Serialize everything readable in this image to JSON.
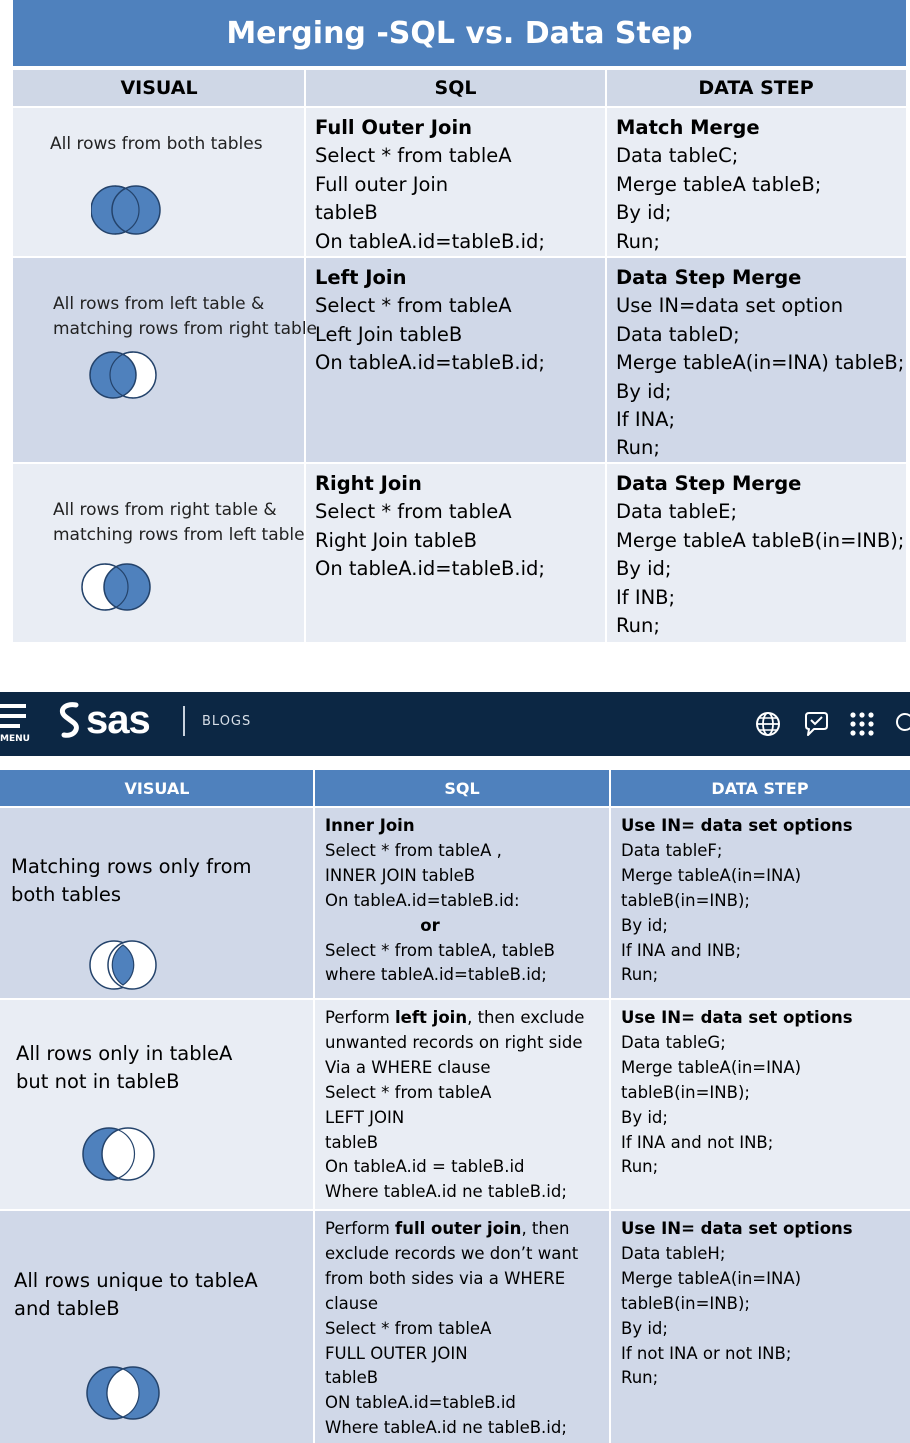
{
  "top_table": {
    "title": "Merging -SQL vs. Data Step",
    "headers": {
      "visual": "VISUAL",
      "sql": "SQL",
      "datastep": "DATA STEP"
    },
    "rows": [
      {
        "visual_lines": [
          "All rows from both tables"
        ],
        "sql_title": "Full Outer Join",
        "sql_lines": [
          "Select * from tableA",
          "Full outer Join",
          "tableB",
          "On tableA.id=tableB.id;"
        ],
        "ds_title": "Match Merge",
        "ds_lines": [
          "Data tableC;",
          "Merge tableA tableB;",
          "By id;",
          "Run;"
        ]
      },
      {
        "visual_lines": [
          "All rows from left table &",
          "matching rows from right table"
        ],
        "sql_title": "Left Join",
        "sql_lines": [
          "Select * from tableA",
          "Left Join tableB",
          "On tableA.id=tableB.id;"
        ],
        "ds_title": "Data Step Merge",
        "ds_lines": [
          "Use IN=data set option",
          "Data tableD;",
          "Merge tableA(in=INA) tableB;",
          "By id;",
          "If INA;",
          "Run;"
        ]
      },
      {
        "visual_lines": [
          "All rows from right table &",
          "matching rows from left table"
        ],
        "sql_title": "Right Join",
        "sql_lines": [
          "Select * from tableA",
          "Right Join tableB",
          "On tableA.id=tableB.id;"
        ],
        "ds_title": "Data Step Merge",
        "ds_lines": [
          "Data tableE;",
          "Merge tableA tableB(in=INB);",
          "By id;",
          "If INB;",
          "Run;"
        ]
      }
    ]
  },
  "sas_bar": {
    "menu_label": "MENU",
    "logo_text": "sas",
    "section_label": "BLOGS",
    "icons": [
      "menu-icon",
      "sas-logo-icon",
      "globe-icon",
      "chat-icon",
      "apps-grid-icon",
      "search-icon"
    ]
  },
  "bottom_table": {
    "headers": {
      "visual": "VISUAL",
      "sql": "SQL",
      "datastep": "DATA STEP"
    },
    "rows": [
      {
        "visual_lines": [
          "Matching rows only from",
          "both tables"
        ],
        "sql_title": "Inner Join",
        "sql_lines": [
          "Select * from tableA ,",
          "INNER JOIN    tableB",
          "On tableA.id=tableB.id:"
        ],
        "sql_or": "or",
        "sql_lines_after": [
          "Select * from tableA, tableB",
          "where   tableA.id=tableB.id;"
        ],
        "ds_title": "Use IN= data set options",
        "ds_lines": [
          "Data tableF;",
          "Merge tableA(in=INA)",
          "tableB(in=INB);",
          "By id;",
          "If INA and INB;",
          "Run;"
        ]
      },
      {
        "visual_lines": [
          "All rows only in tableA",
          "but not in tableB"
        ],
        "sql_first": {
          "pre": "Perform ",
          "bold": "left join",
          "post": ", then exclude"
        },
        "sql_lines": [
          "unwanted records on right side",
          "Via a WHERE clause",
          "Select * from tableA",
          "LEFT JOIN",
          "tableB",
          "On tableA.id  = tableB.id",
          "Where tableA.id ne tableB.id;"
        ],
        "ds_title": "Use IN= data set options",
        "ds_lines": [
          "Data tableG;",
          "Merge tableA(in=INA)",
          "tableB(in=INB);",
          "By id;",
          "If INA and not INB;",
          "Run;"
        ]
      },
      {
        "visual_lines": [
          "All rows unique to tableA",
          "and tableB"
        ],
        "sql_first": {
          "pre": "Perform ",
          "bold": "full outer join",
          "post": ", then"
        },
        "sql_lines": [
          "exclude records we don’t want",
          "from both sides via a WHERE",
          "clause",
          "Select * from tableA",
          "FULL OUTER JOIN",
          "tableB",
          "ON tableA.id=tableB.id",
          "Where tableA.id ne tableB.id;"
        ],
        "ds_title": "Use IN= data set options",
        "ds_lines": [
          "Data tableH;",
          "Merge tableA(in=INA)",
          "tableB(in=INB);",
          "By id;",
          "If not INA or not INB;",
          "Run;"
        ]
      }
    ]
  },
  "colors": {
    "accent_blue": "#4f81bd",
    "venn_fill": "#4f81bd",
    "header_gray_blue": "#cfd7e6",
    "row_light": "#e9edf4",
    "row_dark": "#d0d8e8",
    "sas_navy": "#0c2744"
  }
}
